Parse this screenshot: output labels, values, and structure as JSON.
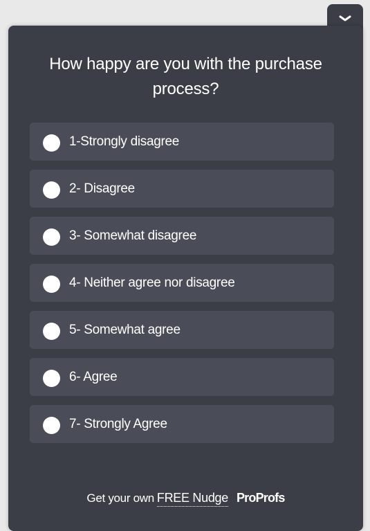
{
  "widget": {
    "collapse_icon": "chevron-down-icon",
    "question": "How happy are you with the purchase process?",
    "options": [
      {
        "label": "1-Strongly disagree"
      },
      {
        "label": "2- Disagree"
      },
      {
        "label": "3- Somewhat disagree"
      },
      {
        "label": "4- Neither agree nor disagree"
      },
      {
        "label": "5- Somewhat agree"
      },
      {
        "label": "6- Agree"
      },
      {
        "label": "7- Strongly Agree"
      }
    ],
    "footer": {
      "text": "Get your own",
      "link": "FREE Nudge",
      "brand": "ProProfs"
    }
  },
  "colors": {
    "panel": "#3b3e47",
    "option_bg": "#4a4d58",
    "page_bg": "#e9e9ea",
    "text": "#ffffff"
  }
}
